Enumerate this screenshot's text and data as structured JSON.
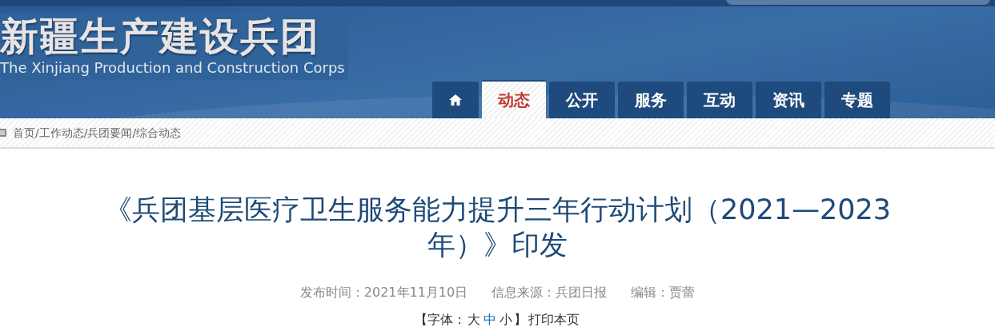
{
  "header": {
    "site_name": "新疆生产建设兵团",
    "site_name_en": "The Xinjiang Production and Construction Corps"
  },
  "nav": [
    {
      "kind": "home",
      "selected": false
    },
    {
      "kind": "text",
      "label": "动态",
      "selected": true
    },
    {
      "kind": "text",
      "label": "公开",
      "selected": false
    },
    {
      "kind": "text",
      "label": "服务",
      "selected": false
    },
    {
      "kind": "text",
      "label": "互动",
      "selected": false
    },
    {
      "kind": "text",
      "label": "资讯",
      "selected": false
    },
    {
      "kind": "text",
      "label": "专题",
      "selected": false
    }
  ],
  "breadcrumb": "首页/工作动态/兵团要闻/综合动态",
  "article": {
    "title": "《兵团基层医疗卫生服务能力提升三年行动计划（2021—2023年）》印发",
    "meta": [
      "发布时间：2021年11月10日",
      "信息来源：兵团日报",
      "编辑：贾蕾"
    ],
    "font_open": "【字体：",
    "font_sizes": [
      {
        "label": "大",
        "selected": false
      },
      {
        "label": "中",
        "selected": true
      },
      {
        "label": "小",
        "selected": false
      }
    ],
    "font_close": "】",
    "print": "打印本页"
  }
}
